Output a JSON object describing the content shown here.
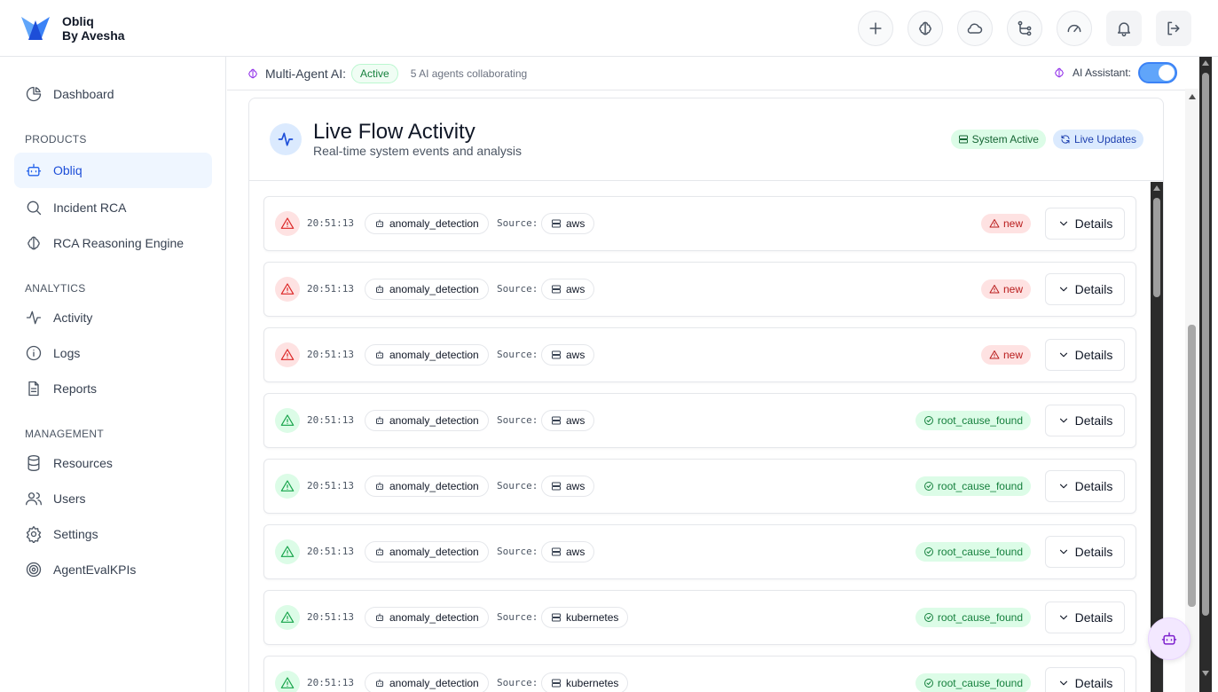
{
  "brand": {
    "name": "Obliq",
    "tagline": "By Avesha"
  },
  "sidebar": {
    "dashboard": "Dashboard",
    "sections": {
      "products": "PRODUCTS",
      "analytics": "ANALYTICS",
      "management": "MANAGEMENT"
    },
    "products": [
      "Obliq",
      "Incident RCA",
      "RCA Reasoning Engine"
    ],
    "analytics": [
      "Activity",
      "Logs",
      "Reports"
    ],
    "management": [
      "Resources",
      "Users",
      "Settings",
      "AgentEvalKPIs"
    ]
  },
  "agentbar": {
    "title": "Multi-Agent AI:",
    "status": "Active",
    "count": "5 AI agents collaborating",
    "assistant_label": "AI Assistant:"
  },
  "card": {
    "title": "Live Flow Activity",
    "subtitle": "Real-time system events and analysis",
    "badge_system": "System Active",
    "badge_live": "Live Updates"
  },
  "list": {
    "source_label": "Source:",
    "details_label": "Details",
    "rows": [
      {
        "time": "20:51:13",
        "type": "anomaly_detection",
        "source": "aws",
        "status": "new"
      },
      {
        "time": "20:51:13",
        "type": "anomaly_detection",
        "source": "aws",
        "status": "new"
      },
      {
        "time": "20:51:13",
        "type": "anomaly_detection",
        "source": "aws",
        "status": "new"
      },
      {
        "time": "20:51:13",
        "type": "anomaly_detection",
        "source": "aws",
        "status": "root_cause_found"
      },
      {
        "time": "20:51:13",
        "type": "anomaly_detection",
        "source": "aws",
        "status": "root_cause_found"
      },
      {
        "time": "20:51:13",
        "type": "anomaly_detection",
        "source": "aws",
        "status": "root_cause_found"
      },
      {
        "time": "20:51:13",
        "type": "anomaly_detection",
        "source": "kubernetes",
        "status": "root_cause_found"
      },
      {
        "time": "20:51:13",
        "type": "anomaly_detection",
        "source": "kubernetes",
        "status": "root_cause_found"
      }
    ]
  },
  "colors": {
    "accent": "#2563eb",
    "active_bg": "#eff6ff",
    "red": "#dc2626",
    "green": "#16a34a",
    "purple": "#9333ea"
  }
}
